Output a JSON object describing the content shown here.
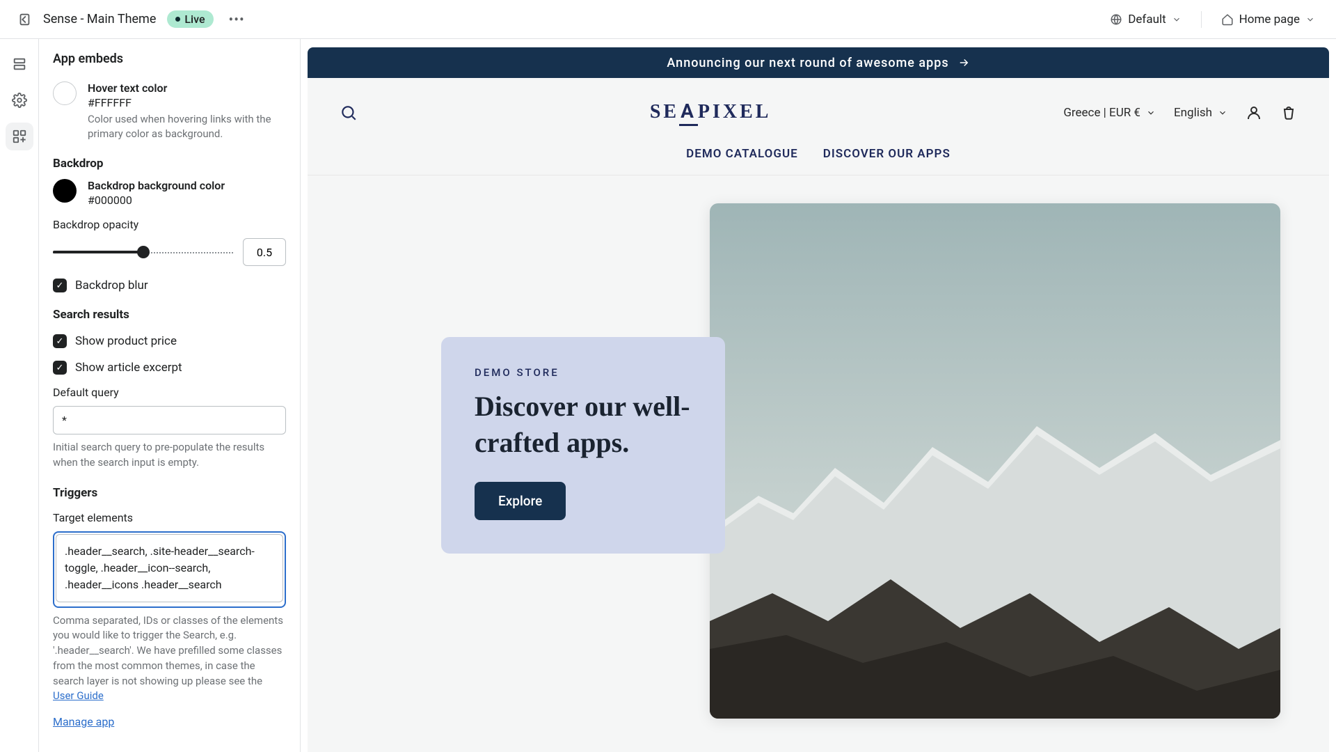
{
  "topbar": {
    "theme": "Sense - Main Theme",
    "live": "Live",
    "device": "Default",
    "page": "Home page"
  },
  "sidebar": {
    "title": "App embeds",
    "hover": {
      "label": "Hover text color",
      "hex": "#FFFFFF",
      "desc": "Color used when hovering links with the primary color as background."
    },
    "backdrop": {
      "heading": "Backdrop",
      "bg_label": "Backdrop background color",
      "bg_hex": "#000000",
      "opacity_label": "Backdrop opacity",
      "opacity_value": "0.5",
      "blur_label": "Backdrop blur"
    },
    "results": {
      "heading": "Search results",
      "price": "Show product price",
      "excerpt": "Show article excerpt",
      "default_query_label": "Default query",
      "default_query_value": "*",
      "default_query_help": "Initial search query to pre-populate the results when the search input is empty."
    },
    "triggers": {
      "heading": "Triggers",
      "target_label": "Target elements",
      "target_value": ".header__search, .site-header__search-toggle, .header__icon--search, .header__icons .header__search",
      "target_help_a": "Comma separated, IDs or classes of the elements you would like to trigger the Search, e.g. '.header__search'. We have prefilled some classes from the most common themes, in case the search layer is not showing up please see the ",
      "target_help_link": "User Guide",
      "manage": "Manage app"
    }
  },
  "site": {
    "announcement": "Announcing our next round of awesome apps",
    "brand": "SEAPIXEL",
    "region": "Greece | EUR €",
    "language": "English",
    "nav": {
      "a": "DEMO CATALOGUE",
      "b": "DISCOVER OUR APPS"
    },
    "hero": {
      "eyebrow": "DEMO STORE",
      "title": "Discover our well-crafted apps.",
      "cta": "Explore"
    }
  }
}
